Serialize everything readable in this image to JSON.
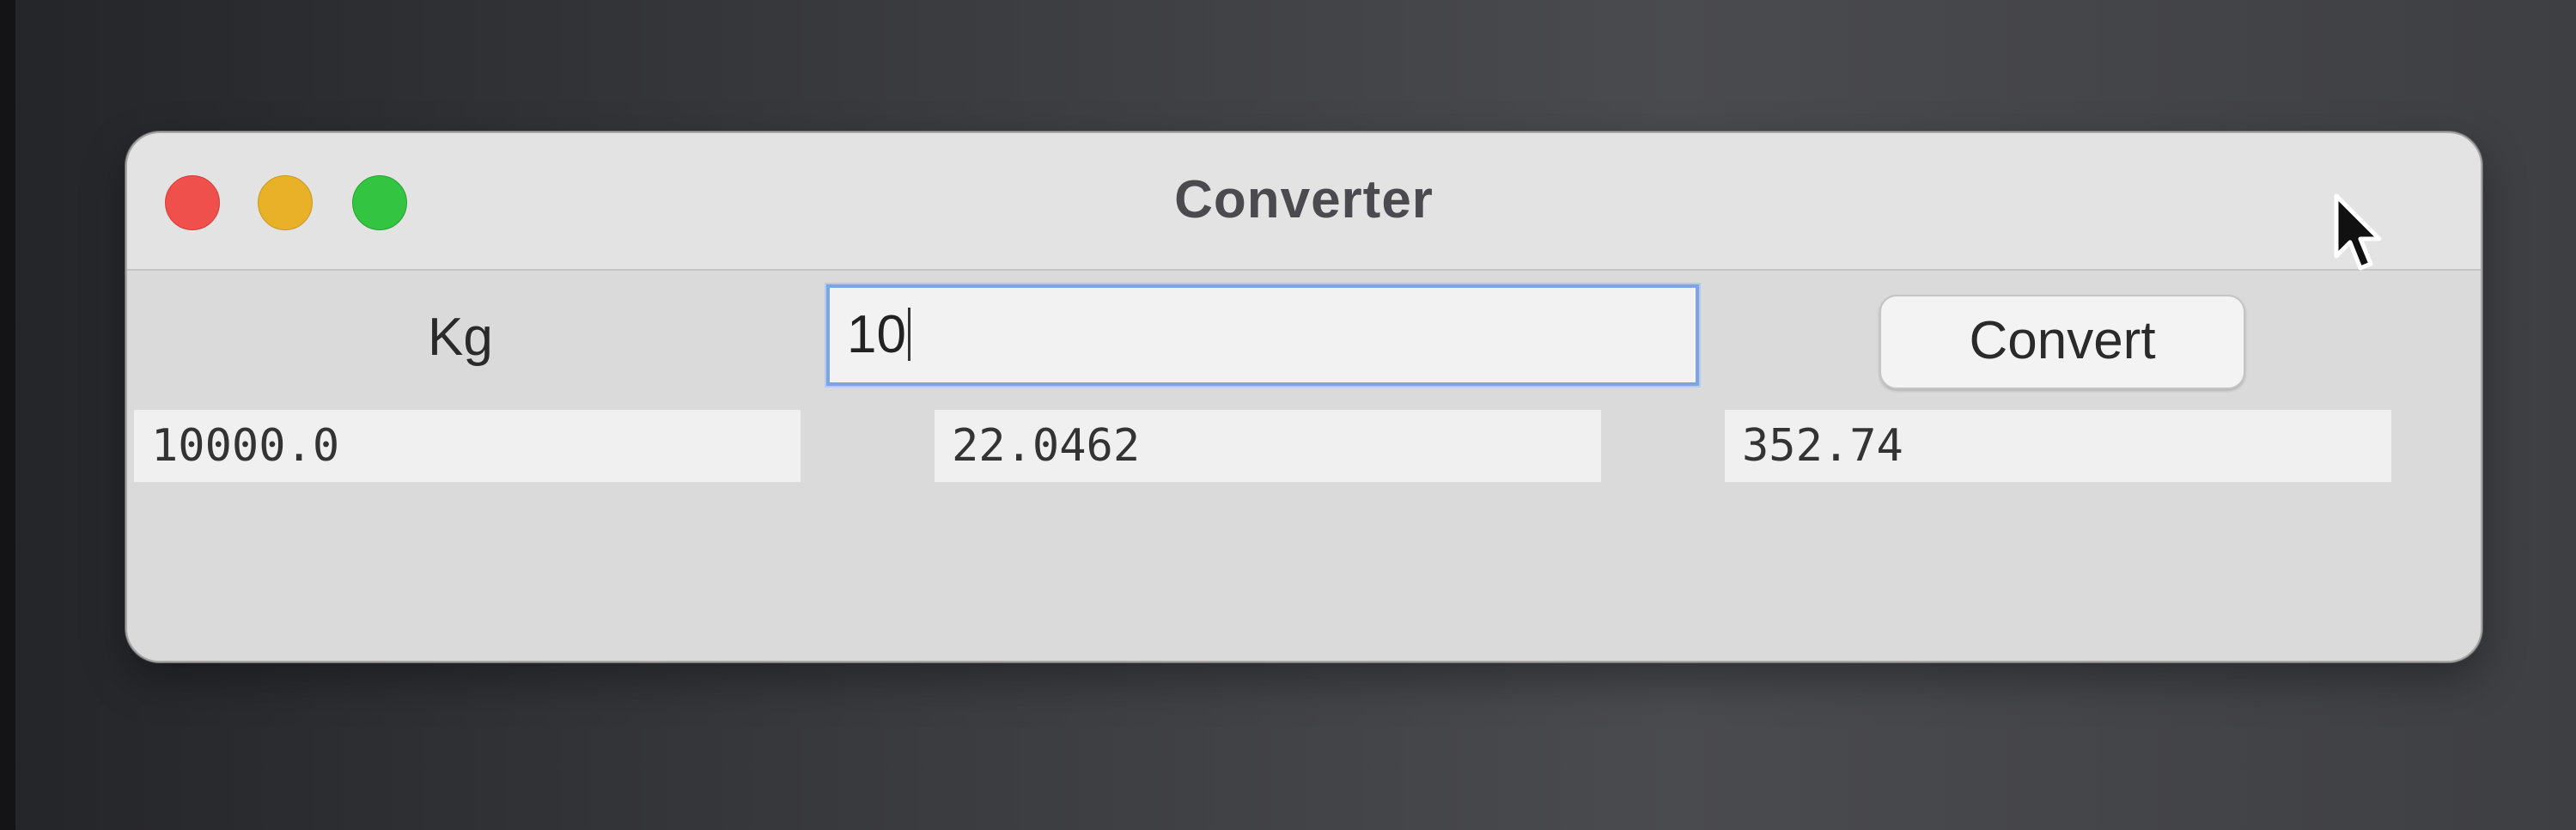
{
  "window": {
    "title": "Converter"
  },
  "form": {
    "unit_label": "Kg",
    "input_value": "10",
    "convert_label": "Convert"
  },
  "results": [
    "10000.0",
    "22.0462",
    "352.74"
  ],
  "colors": {
    "close": "#f0504b",
    "minimize": "#e9b128",
    "maximize": "#33c441",
    "focus_ring": "#7ea5de"
  }
}
